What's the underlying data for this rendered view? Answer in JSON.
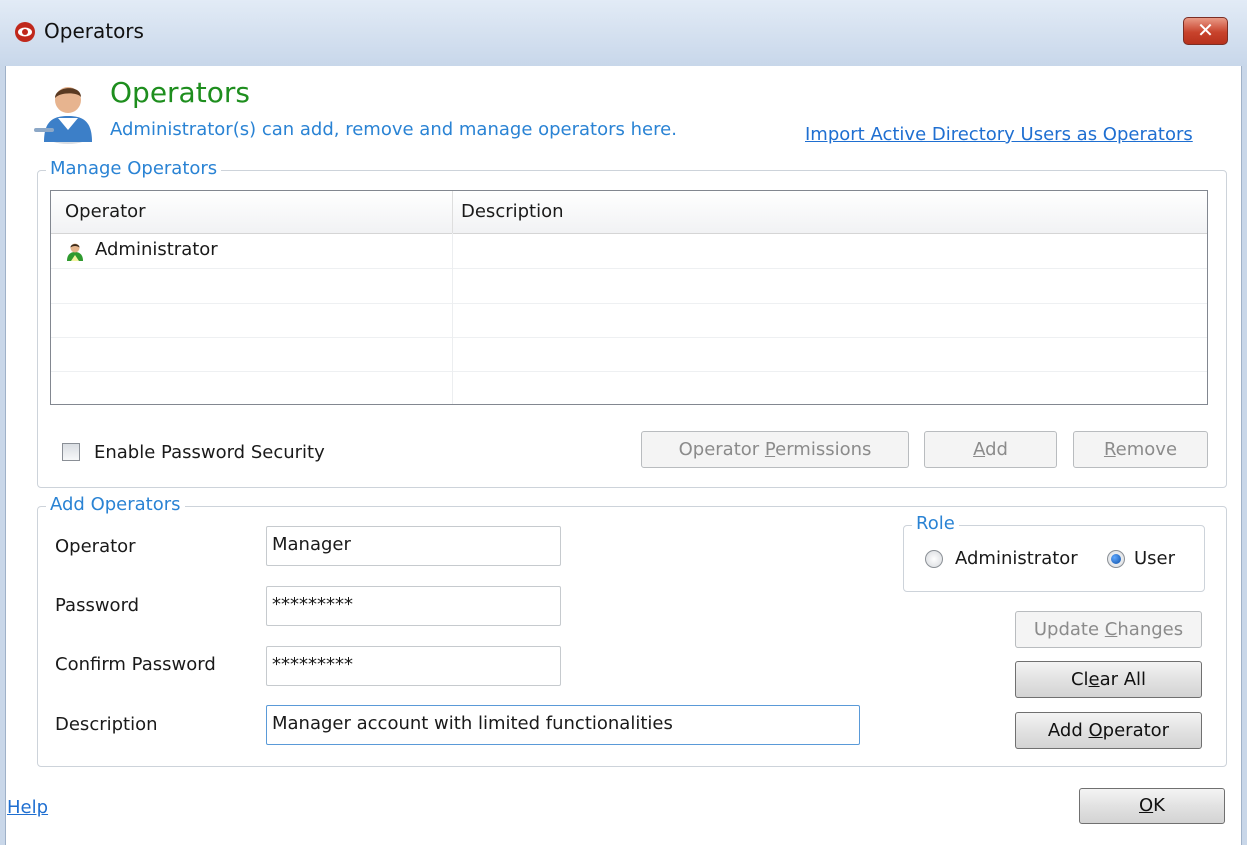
{
  "window": {
    "title": "Operators",
    "close_glyph": "✕"
  },
  "header": {
    "title": "Operators",
    "subtitle": "Administrator(s) can add, remove and manage operators here.",
    "import_link": "Import Active Directory Users as Operators"
  },
  "manage": {
    "legend": "Manage Operators",
    "columns": [
      "Operator",
      "Description"
    ],
    "rows": [
      {
        "operator": "Administrator",
        "description": ""
      }
    ],
    "enable_password_label": "Enable Password Security",
    "enable_password_checked": false,
    "buttons": {
      "permissions_pre": "Operator ",
      "permissions_key": "P",
      "permissions_post": "ermissions",
      "add_key": "A",
      "add_post": "dd",
      "remove_key": "R",
      "remove_post": "emove"
    }
  },
  "add": {
    "legend": "Add Operators",
    "labels": {
      "operator": "Operator",
      "password": "Password",
      "confirm": "Confirm Password",
      "description": "Description"
    },
    "values": {
      "operator": "Manager",
      "password": "*********",
      "confirm": "*********",
      "description": "Manager account with limited functionalities"
    },
    "role": {
      "legend": "Role",
      "options": [
        "Administrator",
        "User"
      ],
      "selected": "User"
    },
    "buttons": {
      "update_pre": "Update ",
      "update_key": "C",
      "update_post": "hanges",
      "clear_pre": "Cl",
      "clear_key": "e",
      "clear_post": "ar All",
      "addop_pre": "Add ",
      "addop_key": "O",
      "addop_post": "perator"
    }
  },
  "footer": {
    "help": "Help",
    "ok_key": "O",
    "ok_post": "K"
  },
  "icons": {
    "app": "red-eye-icon",
    "header": "operator-person-icon",
    "row": "green-user-icon"
  },
  "colors": {
    "title_green": "#1e8e1e",
    "subtitle_blue": "#2a83d4",
    "link_blue": "#1f6fd1",
    "close_red": "#c8432c"
  }
}
